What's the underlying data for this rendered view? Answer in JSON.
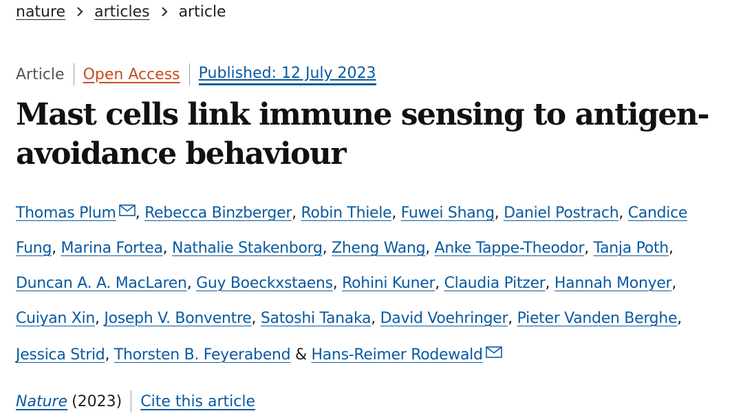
{
  "breadcrumb": {
    "items": [
      "nature",
      "articles"
    ],
    "current": "article"
  },
  "meta": {
    "type": "Article",
    "open_access": "Open Access",
    "published": "Published: 12 July 2023"
  },
  "title": "Mast cells link immune sensing to antigen-avoidance behaviour",
  "authors": [
    {
      "name": "Thomas Plum",
      "mail": true,
      "sep": ", "
    },
    {
      "name": "Rebecca Binzberger",
      "mail": false,
      "sep": ", "
    },
    {
      "name": "Robin Thiele",
      "mail": false,
      "sep": ", "
    },
    {
      "name": "Fuwei Shang",
      "mail": false,
      "sep": ", "
    },
    {
      "name": "Daniel Postrach",
      "mail": false,
      "sep": ", "
    },
    {
      "name": "Candice Fung",
      "mail": false,
      "sep": ", "
    },
    {
      "name": "Marina Fortea",
      "mail": false,
      "sep": ", "
    },
    {
      "name": "Nathalie Stakenborg",
      "mail": false,
      "sep": ", "
    },
    {
      "name": "Zheng Wang",
      "mail": false,
      "sep": ", "
    },
    {
      "name": "Anke Tappe-Theodor",
      "mail": false,
      "sep": ", "
    },
    {
      "name": "Tanja Poth",
      "mail": false,
      "sep": ", "
    },
    {
      "name": "Duncan A. A. MacLaren",
      "mail": false,
      "sep": ", "
    },
    {
      "name": "Guy Boeckxstaens",
      "mail": false,
      "sep": ", "
    },
    {
      "name": "Rohini Kuner",
      "mail": false,
      "sep": ", "
    },
    {
      "name": "Claudia Pitzer",
      "mail": false,
      "sep": ", "
    },
    {
      "name": "Hannah Monyer",
      "mail": false,
      "sep": ", "
    },
    {
      "name": "Cuiyan Xin",
      "mail": false,
      "sep": ", "
    },
    {
      "name": "Joseph V. Bonventre",
      "mail": false,
      "sep": ", "
    },
    {
      "name": "Satoshi Tanaka",
      "mail": false,
      "sep": ", "
    },
    {
      "name": "David Voehringer",
      "mail": false,
      "sep": ", "
    },
    {
      "name": "Pieter Vanden Berghe",
      "mail": false,
      "sep": ", "
    },
    {
      "name": "Jessica Strid",
      "mail": false,
      "sep": ", "
    },
    {
      "name": "Thorsten B. Feyerabend",
      "mail": false,
      "sep": " & "
    },
    {
      "name": "Hans-Reimer Rodewald",
      "mail": true,
      "sep": ""
    }
  ],
  "citation": {
    "journal": "Nature",
    "year": "(2023)",
    "cite": "Cite this article"
  },
  "colors": {
    "link": "#0a5aa0",
    "open_access": "#c64c20",
    "text": "#222222"
  },
  "icons": {
    "breadcrumb_separator": "chevron-right-icon",
    "author_contact": "mail-icon"
  }
}
